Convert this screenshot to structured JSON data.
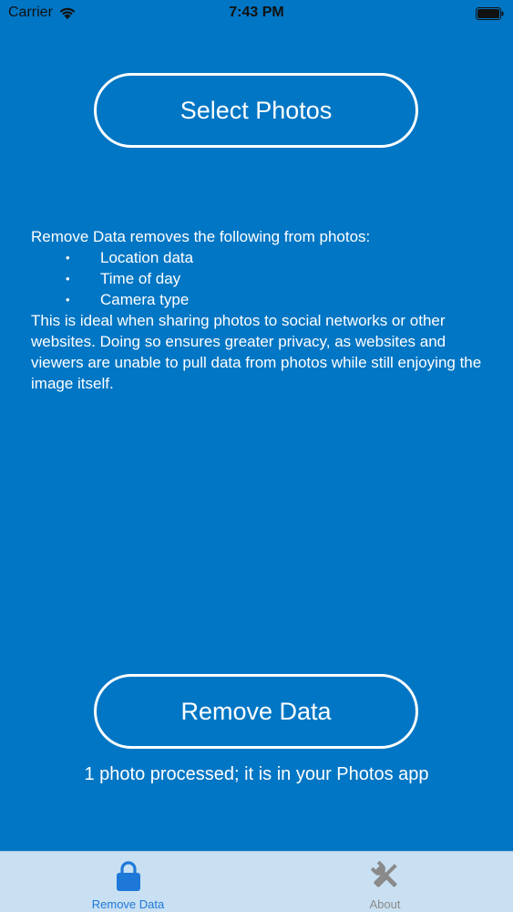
{
  "status_bar": {
    "carrier": "Carrier",
    "time": "7:43 PM"
  },
  "colors": {
    "background": "#0076C4",
    "tab_bar": "#C8E0F2",
    "active_tab": "#1E78D8",
    "inactive_tab": "#8A8A8A"
  },
  "main": {
    "select_button_label": "Select Photos",
    "description": {
      "intro": "Remove Data removes the following from photos:",
      "items": [
        "Location data",
        "Time of day",
        "Camera type"
      ],
      "outro": "This is ideal when sharing photos to social networks or other websites. Doing so ensures greater privacy, as websites and viewers are unable to pull data from photos while still enjoying the image itself."
    },
    "remove_button_label": "Remove Data",
    "status_message": "1 photo processed; it is in your Photos app"
  },
  "tab_bar": {
    "tabs": [
      {
        "label": "Remove Data",
        "icon": "lock-icon",
        "active": true
      },
      {
        "label": "About",
        "icon": "tools-icon",
        "active": false
      }
    ]
  }
}
